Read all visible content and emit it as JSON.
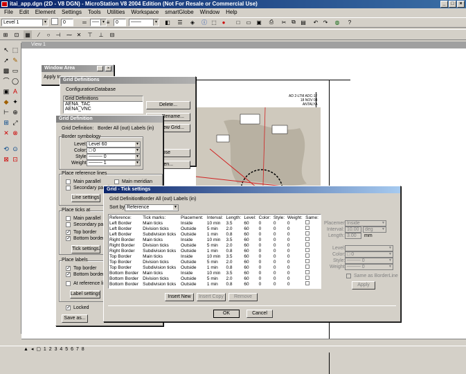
{
  "app": {
    "title": "itai_app.dgn (2D - V8 DGN) - MicroStation V8 2004 Edition (Not For Resale or Commercial Use)"
  },
  "menu": [
    "File",
    "Edit",
    "Element",
    "Settings",
    "Tools",
    "Utilities",
    "Workspace",
    "smartGlobe",
    "Window",
    "Help"
  ],
  "attributes": {
    "level": "Level 1",
    "color": "0",
    "weight": "0"
  },
  "view": {
    "title": "View 1"
  },
  "window_area": {
    "title": "Window Area",
    "apply_to": "Apply to"
  },
  "grid_defs": {
    "title": "Grid Definitions",
    "configuration_label": "Configuration:",
    "configuration_value": "Database",
    "list_header": "Grid Definitions",
    "items": [
      "AENA_TAC",
      "AENA_VNC"
    ],
    "buttons": {
      "delete": "Delete...",
      "rename": "Rename...",
      "view_grid": "View Grid...",
      "close": "Close",
      "open": "Open..."
    }
  },
  "grid_def": {
    "title": "Grid Definition",
    "definition_label": "Grid Definition:",
    "definition_value": "Border All (out) Labels (in)",
    "symbology_title": "Border symbology",
    "level_label": "Level:",
    "level_value": "Level 60",
    "color_label": "Color:",
    "color_value": "0",
    "style_label": "Style:",
    "style_value": "0",
    "weight_label": "Weight:",
    "weight_value": "1",
    "ref_lines_title": "Place reference lines",
    "main_parallel": "Main parallel",
    "main_meridian": "Main meridian",
    "secondary_parallel": "Secondary parall",
    "line_settings": "Line settings...",
    "ticks_title": "Place ticks at",
    "ticks_main_parallel": "Main parallel",
    "ticks_secondary_parallel": "Secondary parall",
    "top_border": "Top border",
    "bottom_border": "Bottom border",
    "tick_settings": "Tick settings...",
    "labels_title": "Place labels",
    "labels_top_border": "Top border",
    "labels_bottom_border": "Bottom border",
    "at_reference_line": "At reference line",
    "label_settings": "Label settings...",
    "locked": "Locked",
    "save_as": "Save as..."
  },
  "tick_settings": {
    "title": "Grid - Tick settings",
    "definition_label": "Grid Definition:",
    "definition_value": "Border All (out) Labels (in)",
    "sort_by_label": "Sort by",
    "sort_by_value": "Reference",
    "columns": [
      "Reference:",
      "Tick marks:",
      "Placement:",
      "Interval:",
      "Length:",
      "Level:",
      "Color:",
      "Style:",
      "Weight:",
      "Same:"
    ],
    "rows": [
      [
        "Left Border",
        "Main ticks",
        "Inside",
        "10 min",
        "3.5",
        "60",
        "0",
        "0",
        "0"
      ],
      [
        "Left Border",
        "Division ticks",
        "Outside",
        "5 min",
        "2.0",
        "60",
        "0",
        "0",
        "0"
      ],
      [
        "Left Border",
        "Subdivision ticks",
        "Outside",
        "1 min",
        "0.8",
        "60",
        "0",
        "0",
        "0"
      ],
      [
        "Right Border",
        "Main ticks",
        "Inside",
        "10 min",
        "3.5",
        "60",
        "0",
        "0",
        "0"
      ],
      [
        "Right Border",
        "Division ticks",
        "Outside",
        "5 min",
        "2.0",
        "60",
        "0",
        "0",
        "0"
      ],
      [
        "Right Border",
        "Subdivision ticks",
        "Outside",
        "1 min",
        "0.8",
        "60",
        "0",
        "0",
        "0"
      ],
      [
        "Top Border",
        "Main ticks",
        "Inside",
        "10 min",
        "3.5",
        "60",
        "0",
        "0",
        "0"
      ],
      [
        "Top Border",
        "Division ticks",
        "Outside",
        "5 min",
        "2.0",
        "60",
        "0",
        "0",
        "0"
      ],
      [
        "Top Border",
        "Subdivision ticks",
        "Outside",
        "1 min",
        "0.8",
        "60",
        "0",
        "0",
        "0"
      ],
      [
        "Bottom Border",
        "Main ticks",
        "Inside",
        "10 min",
        "3.5",
        "60",
        "0",
        "0",
        "0"
      ],
      [
        "Bottom Border",
        "Division ticks",
        "Outside",
        "5 min",
        "2.0",
        "60",
        "0",
        "0",
        "0"
      ],
      [
        "Bottom Border",
        "Subdivision ticks",
        "Outside",
        "1 min",
        "0.8",
        "60",
        "0",
        "0",
        "0"
      ]
    ],
    "insert_new": "Insert New",
    "insert_copy": "Insert Copy",
    "remove": "Remove",
    "placement_label": "Placement:",
    "placement_value": "Inside",
    "interval_label": "Interval:",
    "interval_value": "10.00",
    "interval_unit": "deg",
    "length_label": "Length:",
    "length_value": "3.00",
    "length_unit": "mm",
    "level_label": "Level:",
    "color_label": "Color:",
    "color_value": "0",
    "style_label": "Style:",
    "style_value": "0",
    "weight_label": "Weight:",
    "weight_value": "0",
    "same_as_border": "Same as BorderLine",
    "apply": "Apply",
    "ok": "OK",
    "cancel": "Cancel"
  },
  "drawing": {
    "line1": "AD 2-LTM ADC-1F",
    "line2": "18 NOV 04",
    "line3": "ANTALYA"
  }
}
